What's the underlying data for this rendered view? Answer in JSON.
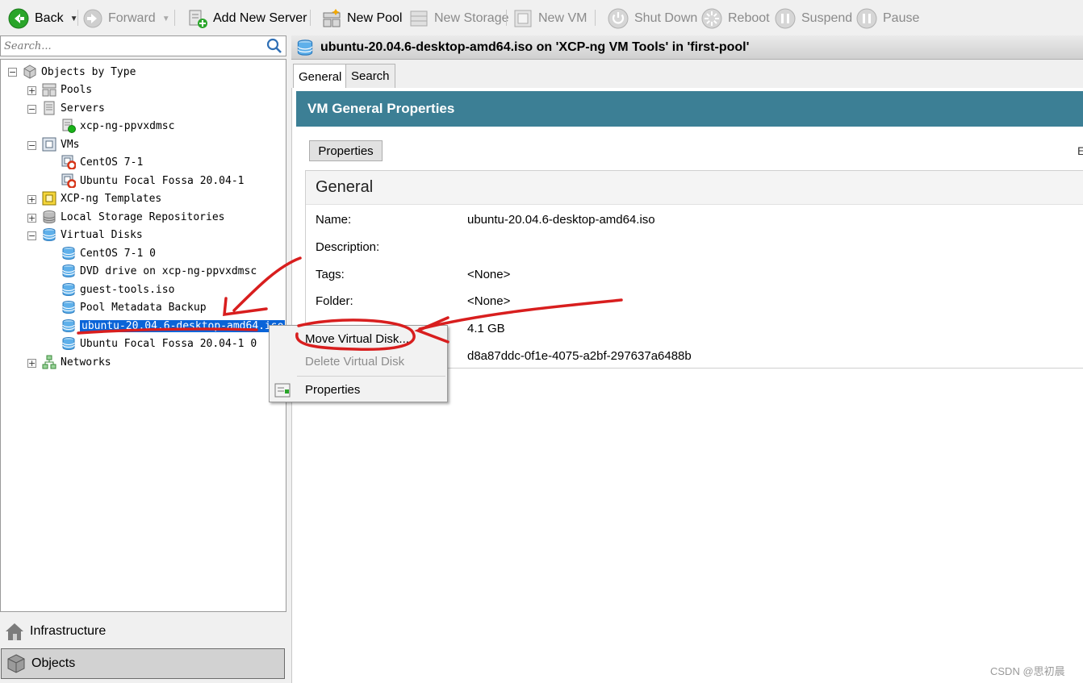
{
  "toolbar": {
    "back": "Back",
    "forward": "Forward",
    "add_server": "Add New Server",
    "new_pool": "New Pool",
    "new_storage": "New Storage",
    "new_vm": "New VM",
    "shut_down": "Shut Down",
    "reboot": "Reboot",
    "suspend": "Suspend",
    "pause": "Pause"
  },
  "search": {
    "placeholder": "Search..."
  },
  "tree": {
    "root": "Objects by Type",
    "pools": "Pools",
    "servers": "Servers",
    "server_host": "xcp-ng-ppvxdmsc",
    "vms": "VMs",
    "vm1": "CentOS 7-1",
    "vm2": "Ubuntu Focal Fossa 20.04-1",
    "templates": "XCP-ng Templates",
    "local_sr": "Local Storage Repositories",
    "virtual_disks": "Virtual Disks",
    "disk1": "CentOS 7-1 0",
    "disk2": "DVD drive on xcp-ng-ppvxdmsc",
    "disk3": "guest-tools.iso",
    "disk4": "Pool Metadata Backup",
    "disk5": "ubuntu-20.04.6-desktop-amd64.iso",
    "disk6": "Ubuntu Focal Fossa 20.04-1 0",
    "networks": "Networks"
  },
  "nav": {
    "infrastructure": "Infrastructure",
    "objects": "Objects"
  },
  "header": {
    "title": "ubuntu-20.04.6-desktop-amd64.iso on 'XCP-ng VM Tools' in 'first-pool'"
  },
  "tabs": {
    "general": "General",
    "search": "Search"
  },
  "content": {
    "banner": "VM General Properties",
    "properties_button": "Properties",
    "edge_text": "E",
    "section_title": "General",
    "name_label": "Name:",
    "name_value": "ubuntu-20.04.6-desktop-amd64.iso",
    "description_label": "Description:",
    "tags_label": "Tags:",
    "tags_value": "<None>",
    "folder_label": "Folder:",
    "folder_value": "<None>",
    "size_value": "4.1 GB",
    "uuid_value": "d8a87ddc-0f1e-4075-a2bf-297637a6488b"
  },
  "context_menu": {
    "move": "Move Virtual Disk...",
    "delete": "Delete Virtual Disk",
    "properties": "Properties"
  },
  "watermark": "CSDN @思初晨",
  "colors": {
    "banner": "#3c7f95",
    "selection": "#0a64d8",
    "annotation": "#d81e1e"
  }
}
